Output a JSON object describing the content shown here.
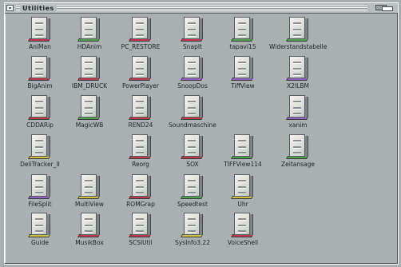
{
  "window": {
    "title": "Utilities"
  },
  "colors": {
    "red": "#c0394a",
    "green": "#4ea24a",
    "purple": "#8f62c2",
    "yellow": "#cfc13d"
  },
  "icons": [
    {
      "label": "AniMan",
      "color": "#c0394a",
      "icon": "drawer-icon"
    },
    {
      "label": "HDAnim",
      "color": "#4ea24a",
      "icon": "drawer-icon"
    },
    {
      "label": "PC_RESTORE",
      "color": "#c0394a",
      "icon": "drawer-icon"
    },
    {
      "label": "SnapIt",
      "color": "#c0394a",
      "icon": "drawer-icon"
    },
    {
      "label": "tapavi15",
      "color": "#4ea24a",
      "icon": "drawer-icon"
    },
    {
      "label": "Widerstandstabelle",
      "color": "#4ea24a",
      "icon": "drawer-icon"
    },
    {
      "label": "BigAnim",
      "color": "#c0394a",
      "icon": "drawer-icon"
    },
    {
      "label": "IBM_DRUCK",
      "color": "#c0394a",
      "icon": "drawer-icon"
    },
    {
      "label": "PowerPlayer",
      "color": "#c0394a",
      "icon": "drawer-icon"
    },
    {
      "label": "SnoopDos",
      "color": "#8f62c2",
      "icon": "drawer-icon"
    },
    {
      "label": "TiffView",
      "color": "#8f62c2",
      "icon": "drawer-icon"
    },
    {
      "label": "X2ILBM",
      "color": "#8f62c2",
      "icon": "drawer-icon"
    },
    {
      "label": "CDDARip",
      "color": "#c0394a",
      "icon": "drawer-icon"
    },
    {
      "label": "MagicWB",
      "color": "#4ea24a",
      "icon": "drawer-icon"
    },
    {
      "label": "REND24",
      "color": "#c0394a",
      "icon": "drawer-icon"
    },
    {
      "label": "Soundmaschine",
      "color": "#c0394a",
      "icon": "drawer-icon"
    },
    {
      "label": "xanim",
      "color": "#8f62c2",
      "icon": "drawer-icon"
    },
    {
      "label": "DeliTracker_II",
      "color": "#cfc13d",
      "icon": "drawer-icon"
    },
    {
      "label": "Reorg",
      "color": "#c0394a",
      "icon": "drawer-icon"
    },
    {
      "label": "SOX",
      "color": "#c0394a",
      "icon": "drawer-icon"
    },
    {
      "label": "TIFFView114",
      "color": "#4ea24a",
      "icon": "drawer-icon"
    },
    {
      "label": "Zeitansage",
      "color": "#4ea24a",
      "icon": "drawer-icon"
    },
    {
      "label": "FileSplit",
      "color": "#8f62c2",
      "icon": "drawer-icon"
    },
    {
      "label": "MultiView",
      "color": "#cfc13d",
      "icon": "drawer-icon"
    },
    {
      "label": "ROMGrap",
      "color": "#c0394a",
      "icon": "drawer-icon"
    },
    {
      "label": "Speedtest",
      "color": "#4ea24a",
      "icon": "drawer-icon"
    },
    {
      "label": "Uhr",
      "color": "#cfc13d",
      "icon": "drawer-icon"
    },
    {
      "label": "Guide",
      "color": "#cfc13d",
      "icon": "drawer-icon"
    },
    {
      "label": "MusikBox",
      "color": "#c0394a",
      "icon": "drawer-icon"
    },
    {
      "label": "SCSIUtil",
      "color": "#c0394a",
      "icon": "drawer-icon"
    },
    {
      "label": "SysInfo3.22",
      "color": "#cfc13d",
      "icon": "drawer-icon"
    },
    {
      "label": "VoiceShell",
      "color": "#c0394a",
      "icon": "drawer-icon"
    }
  ]
}
